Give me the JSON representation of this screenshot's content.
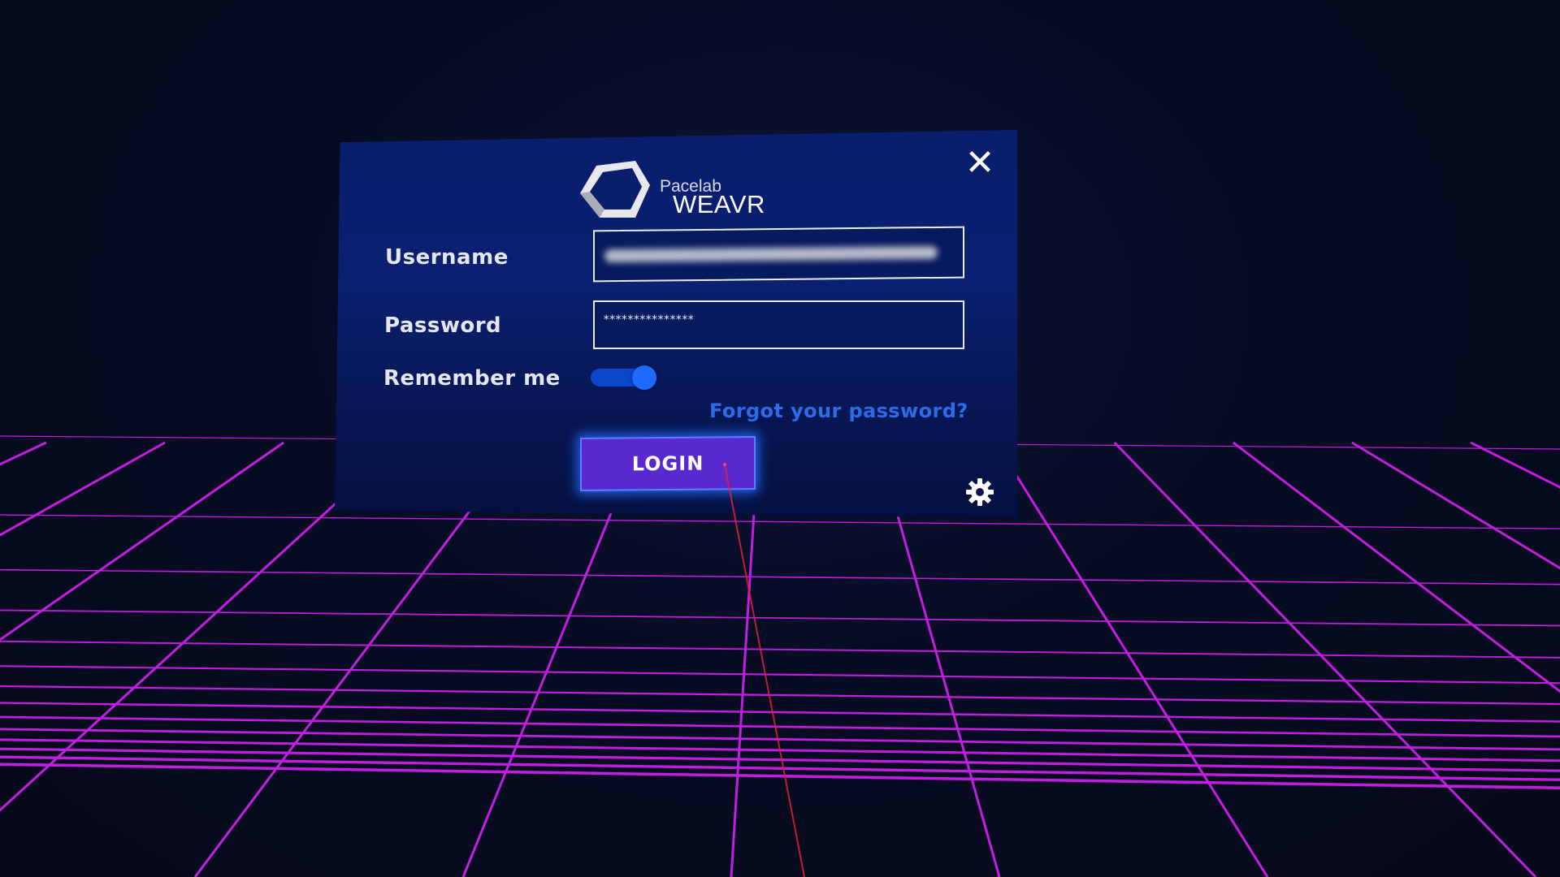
{
  "logo": {
    "brand_small": "Pacelab",
    "brand_big": "WEAVR",
    "icon": "pacelab-hexagon-icon"
  },
  "form": {
    "username_label": "Username",
    "password_label": "Password",
    "password_value": "***************",
    "remember_label": "Remember me",
    "remember_on": true,
    "forgot_link": "Forgot your password?",
    "login_label": "LOGIN"
  },
  "icons": {
    "close": "close-icon",
    "settings": "gear-icon"
  },
  "colors": {
    "grid": "#c21ee0",
    "panel": "#0a1e6e",
    "login_button": "#5a28cf",
    "login_glow": "#286eff",
    "toggle_on": "#1e6bff",
    "link": "#2d6be8",
    "pointer_ray": "#e0203a"
  }
}
